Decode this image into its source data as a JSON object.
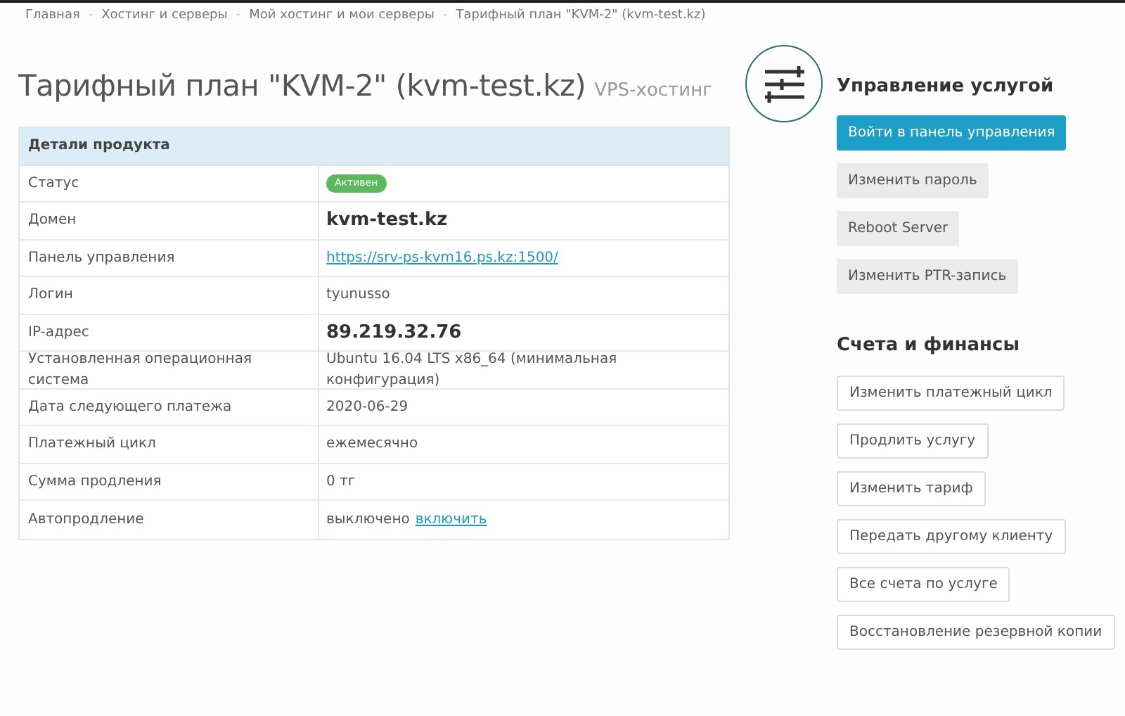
{
  "breadcrumb": {
    "separator": "-",
    "items": [
      "Главная",
      "Хостинг и серверы",
      "Мой хостинг и мои серверы",
      "Тарифный план \"KVM-2\" (kvm-test.kz)"
    ]
  },
  "title": {
    "main": "Тарифный план \"KVM-2\" (kvm-test.kz)",
    "sub": "VPS-хостинг"
  },
  "details": {
    "heading": "Детали продукта",
    "rows": [
      {
        "label": "Статус",
        "kind": "badge",
        "value": "Активен"
      },
      {
        "label": "Домен",
        "kind": "bold",
        "value": "kvm-test.kz"
      },
      {
        "label": "Панель управления",
        "kind": "link",
        "value": "https://srv-ps-kvm16.ps.kz:1500/"
      },
      {
        "label": "Логин",
        "kind": "text",
        "value": "tyunusso"
      },
      {
        "label": "IP-адрес",
        "kind": "bold",
        "value": "89.219.32.76"
      },
      {
        "label": "Установленная операционная система",
        "kind": "text",
        "value": "Ubuntu 16.04 LTS x86_64 (минимальная конфигурация)"
      },
      {
        "label": "Дата следующего платежа",
        "kind": "text",
        "value": "2020-06-29"
      },
      {
        "label": "Платежный цикл",
        "kind": "text",
        "value": "ежемесячно"
      },
      {
        "label": "Сумма продления",
        "kind": "text",
        "value": "0 тг"
      },
      {
        "label": "Автопродление",
        "kind": "text_link",
        "value": "выключено",
        "link": "включить"
      }
    ]
  },
  "sections": [
    {
      "title": "Управление услугой",
      "buttons": [
        {
          "label": "Войти в панель управления",
          "kind": "primary"
        },
        {
          "label": "Изменить пароль",
          "kind": "grey"
        },
        {
          "label": "Reboot Server",
          "kind": "grey"
        },
        {
          "label": "Изменить PTR-запись",
          "kind": "grey"
        }
      ]
    },
    {
      "title": "Счета и финансы",
      "buttons": [
        {
          "label": "Изменить платежный цикл",
          "kind": "outline"
        },
        {
          "label": "Продлить услугу",
          "kind": "outline"
        },
        {
          "label": "Изменить тариф",
          "kind": "outline"
        },
        {
          "label": "Передать другому клиенту",
          "kind": "outline"
        },
        {
          "label": "Все счета по услуге",
          "kind": "outline"
        },
        {
          "label": "Восстановление резервной копии",
          "kind": "outline"
        }
      ]
    }
  ]
}
